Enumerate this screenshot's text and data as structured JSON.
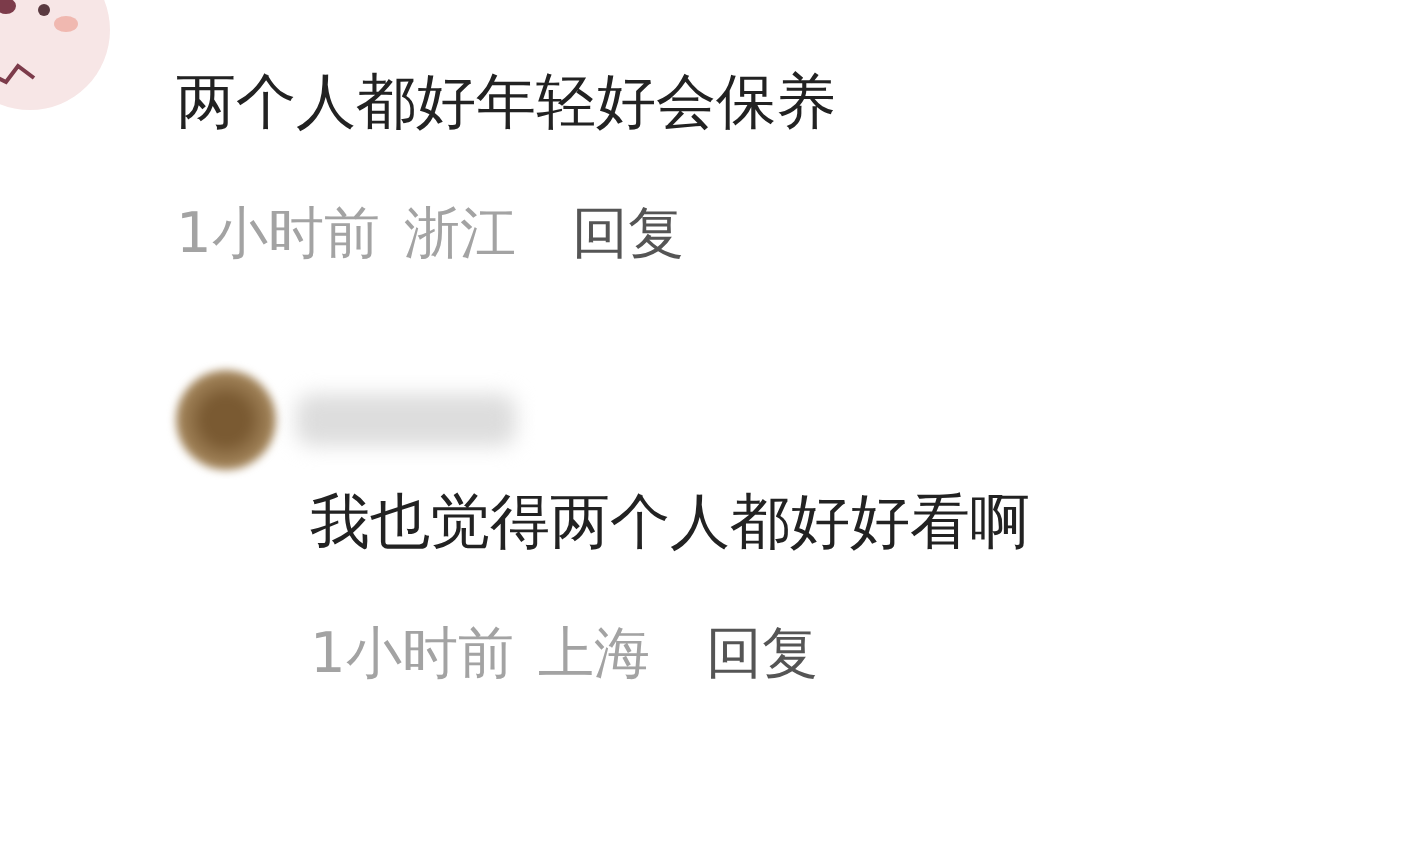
{
  "comments": [
    {
      "text": "两个人都好年轻好会保养",
      "time": "1小时前",
      "location": "浙江",
      "reply_label": "回复",
      "replies": [
        {
          "text": "我也觉得两个人都好好看啊",
          "time": "1小时前",
          "location": "上海",
          "reply_label": "回复"
        }
      ]
    }
  ]
}
